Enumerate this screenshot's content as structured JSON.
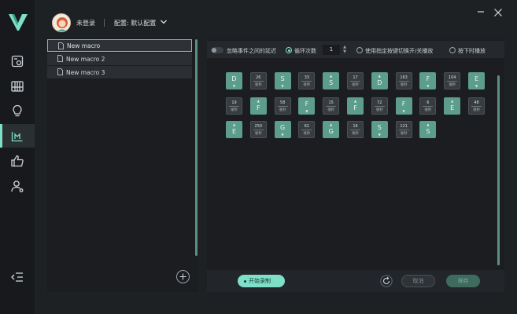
{
  "header": {
    "username": "未登录",
    "profile": "配置: 默认配置"
  },
  "sidebar": {
    "items": [
      {
        "icon": "display-settings-icon"
      },
      {
        "icon": "keyboard-icon"
      },
      {
        "icon": "lightbulb-icon"
      },
      {
        "icon": "macro-icon",
        "active": true
      },
      {
        "icon": "thumbs-up-icon"
      },
      {
        "icon": "user-settings-icon"
      }
    ],
    "collapse_icon": "collapse-menu-icon"
  },
  "macros": {
    "items": [
      {
        "label": "New macro",
        "selected": true
      },
      {
        "label": "New macro 2"
      },
      {
        "label": "New macro 3"
      }
    ]
  },
  "toolbar": {
    "ignore_delay": "忽略事件之间的延迟",
    "loop": "循环次数",
    "loop_count": "1",
    "toggle_mode": "使用指定按键切换开/关播放",
    "hold_mode": "按下时播放"
  },
  "sequence": {
    "unit": "毫秒",
    "rows": [
      [
        {
          "t": "key",
          "label": "D",
          "dir": "down"
        },
        {
          "t": "delay",
          "ms": "26"
        },
        {
          "t": "key",
          "label": "S",
          "dir": "down"
        },
        {
          "t": "delay",
          "ms": "33"
        },
        {
          "t": "key",
          "label": "S",
          "dir": "up"
        },
        {
          "t": "delay",
          "ms": "17"
        },
        {
          "t": "key",
          "label": "D",
          "dir": "up"
        },
        {
          "t": "delay",
          "ms": "163"
        },
        {
          "t": "key",
          "label": "F",
          "dir": "down"
        },
        {
          "t": "delay",
          "ms": "104"
        },
        {
          "t": "key",
          "label": "E",
          "dir": "down"
        }
      ],
      [
        {
          "t": "delay",
          "ms": "19"
        },
        {
          "t": "key",
          "label": "F",
          "dir": "up"
        },
        {
          "t": "delay",
          "ms": "58"
        },
        {
          "t": "key",
          "label": "F",
          "dir": "down"
        },
        {
          "t": "delay",
          "ms": "15"
        },
        {
          "t": "key",
          "label": "F",
          "dir": "up"
        },
        {
          "t": "delay",
          "ms": "72"
        },
        {
          "t": "key",
          "label": "F",
          "dir": "down"
        },
        {
          "t": "delay",
          "ms": "6"
        },
        {
          "t": "key",
          "label": "E",
          "dir": "up"
        },
        {
          "t": "delay",
          "ms": "48"
        }
      ],
      [
        {
          "t": "key",
          "label": "E",
          "dir": "up"
        },
        {
          "t": "delay",
          "ms": "250"
        },
        {
          "t": "key",
          "label": "G",
          "dir": "down"
        },
        {
          "t": "delay",
          "ms": "61"
        },
        {
          "t": "key",
          "label": "G",
          "dir": "up"
        },
        {
          "t": "delay",
          "ms": "16"
        },
        {
          "t": "key",
          "label": "S",
          "dir": "down"
        },
        {
          "t": "delay",
          "ms": "121"
        },
        {
          "t": "key",
          "label": "S",
          "dir": "up"
        }
      ]
    ]
  },
  "footer": {
    "record": "开始录制",
    "cancel": "取消",
    "save": "保存"
  },
  "colors": {
    "accent": "#7ee0c8",
    "key_tile": "#5c9d8b"
  }
}
